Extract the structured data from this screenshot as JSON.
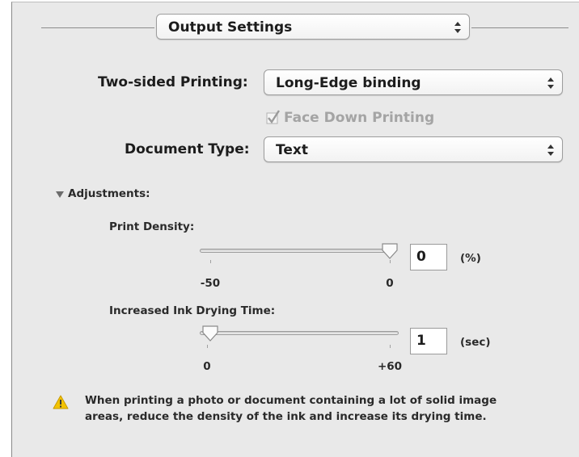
{
  "header": {
    "popup_value": "Output Settings"
  },
  "two_sided": {
    "label": "Two-sided Printing:",
    "value": "Long-Edge binding"
  },
  "face_down": {
    "label": "Face Down Printing",
    "checked": true,
    "enabled": false
  },
  "document_type": {
    "label": "Document Type:",
    "value": "Text"
  },
  "adjustments": {
    "label": "Adjustments:",
    "expanded": true,
    "print_density": {
      "label": "Print Density:",
      "min_label": "-50",
      "max_label": "0",
      "min": -50,
      "max": 0,
      "value": 0,
      "field_value": "0",
      "unit": "(%)"
    },
    "drying_time": {
      "label": "Increased Ink Drying Time:",
      "min_label": "0",
      "max_label": "+60",
      "min": 0,
      "max": 60,
      "value": 1,
      "field_value": "1",
      "unit": "(sec)"
    }
  },
  "warning": {
    "icon": "warning-triangle-icon",
    "line1": "When printing a photo or document containing a lot of solid image",
    "line2": "areas, reduce the density of the ink and increase its drying time."
  },
  "colors": {
    "warning_yellow": "#f3c300",
    "check_gray": "#9a9a9a"
  }
}
